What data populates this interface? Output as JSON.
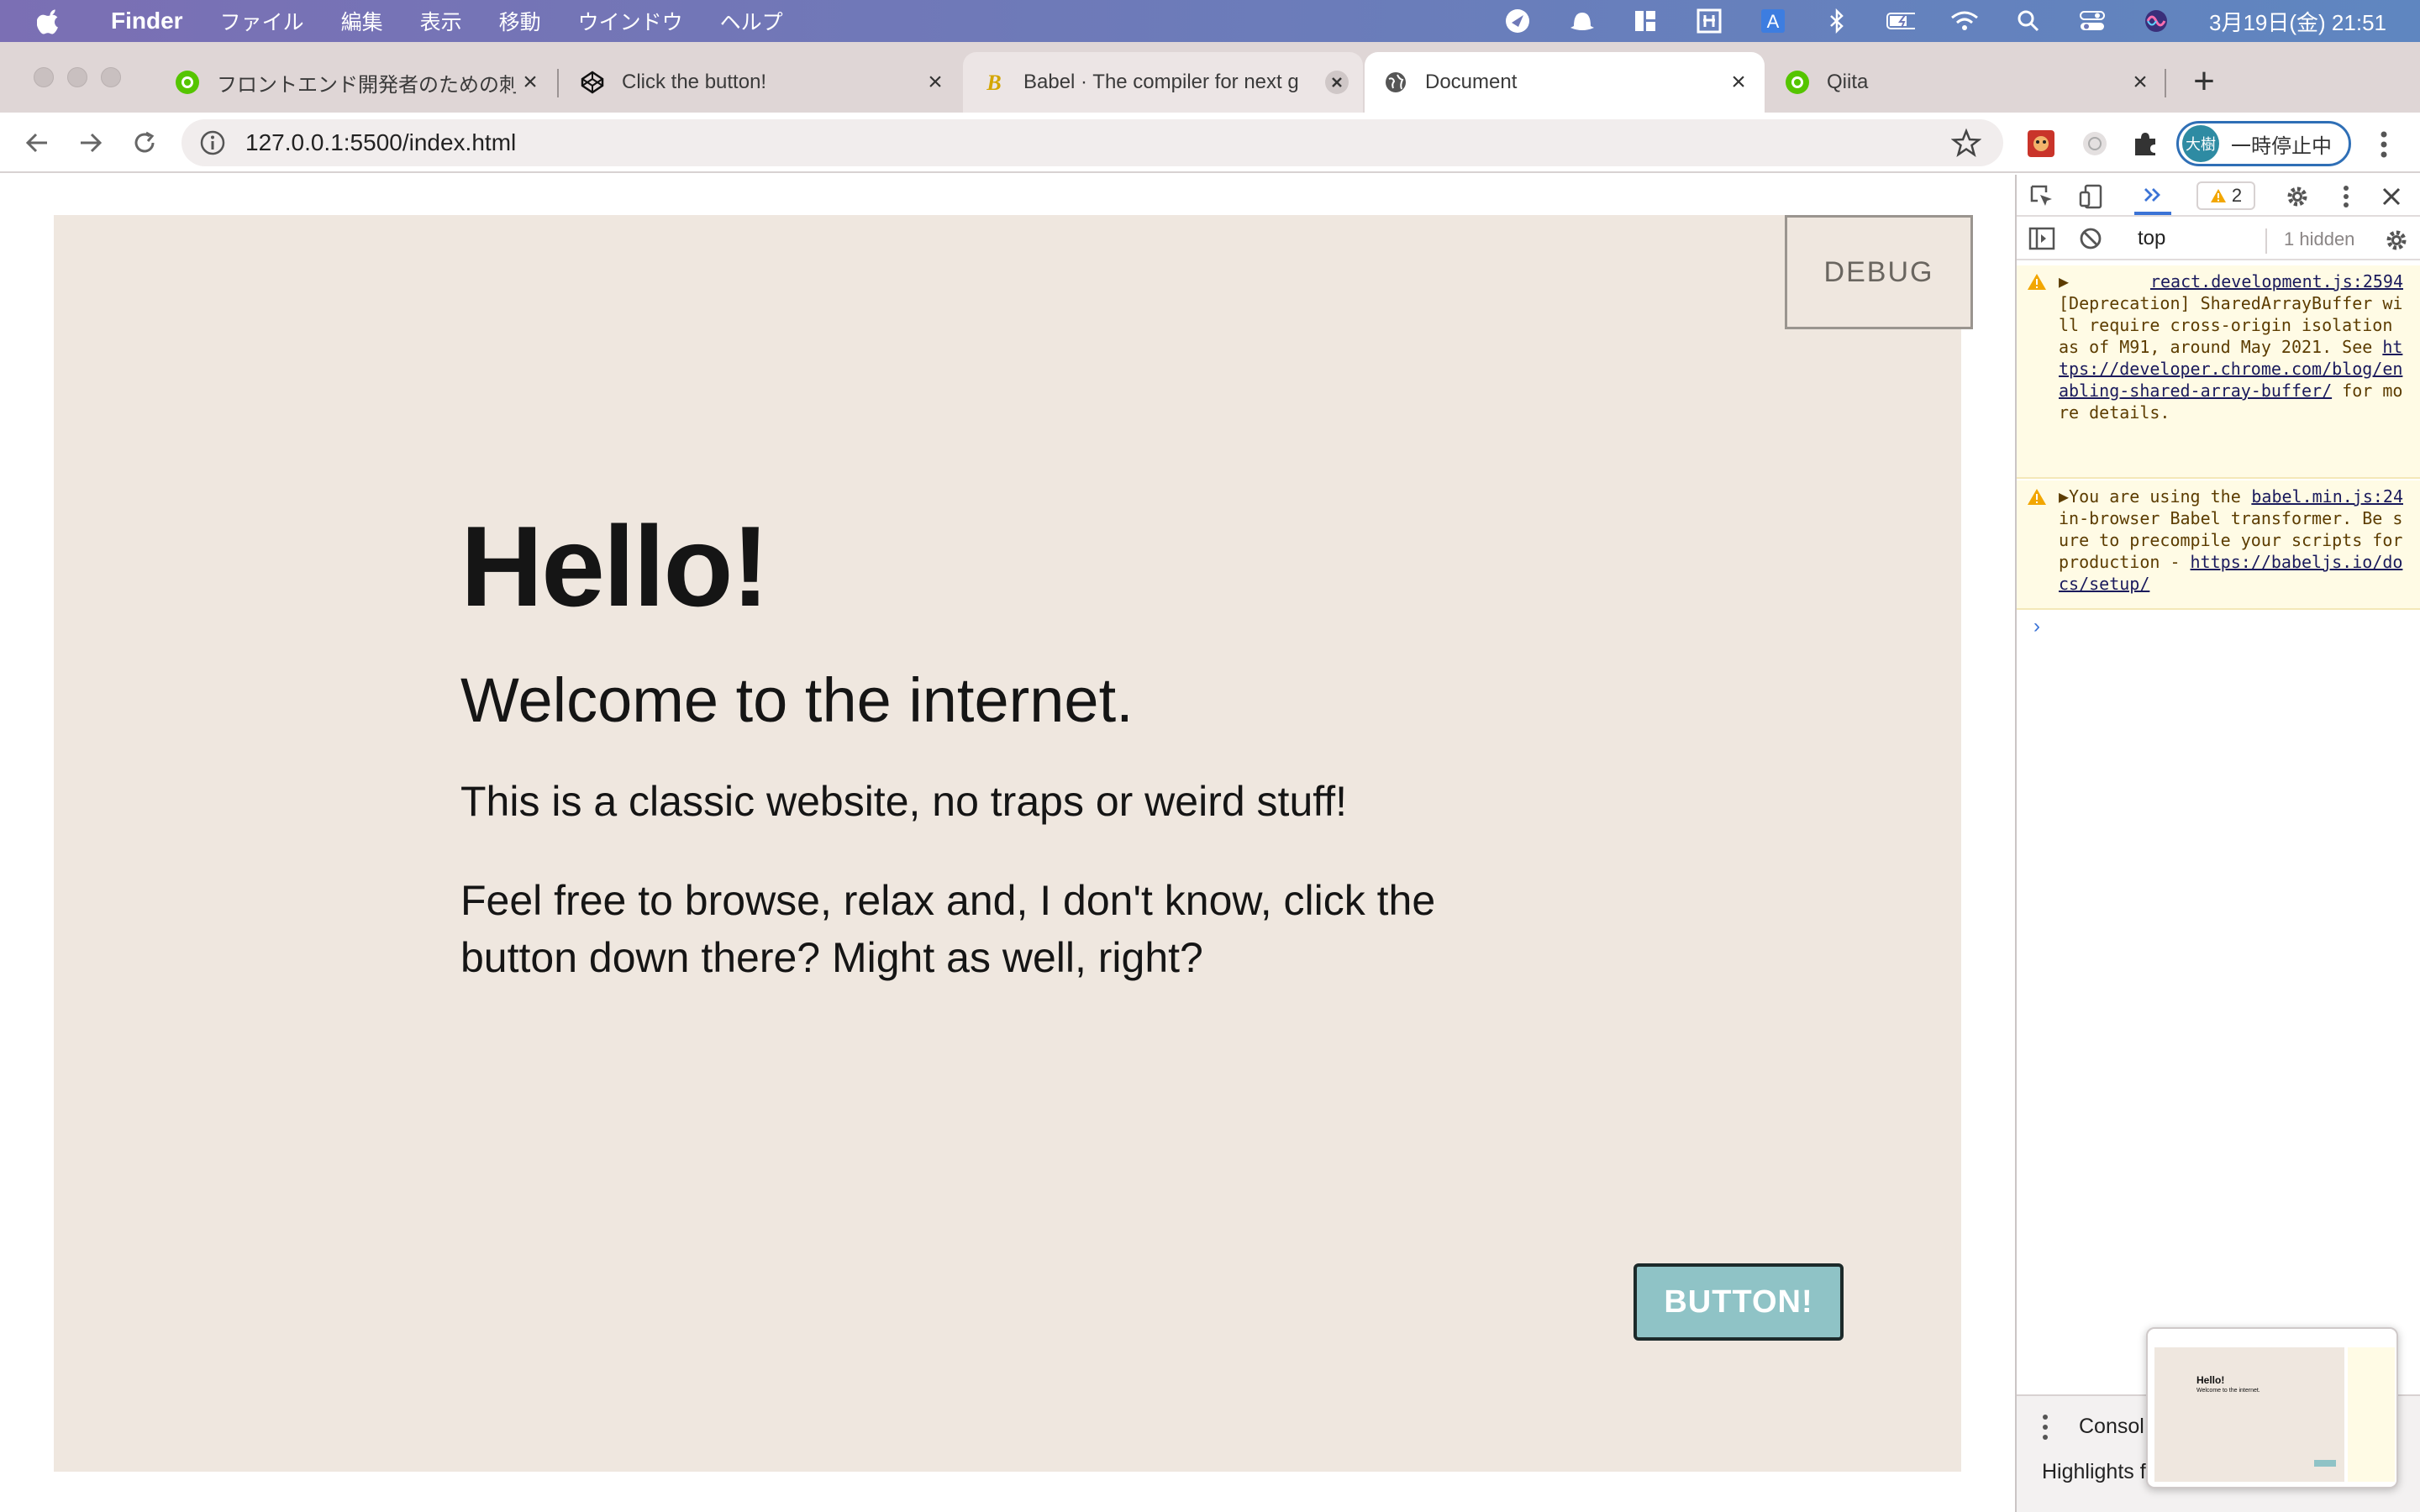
{
  "menubar": {
    "app": "Finder",
    "items": [
      "ファイル",
      "編集",
      "表示",
      "移動",
      "ウインドウ",
      "ヘルプ"
    ],
    "clock": "3月19日(金)  21:51"
  },
  "tabs": [
    {
      "label": "フロントエンド開発者のための刺激",
      "icon": "qiita-icon"
    },
    {
      "label": "Click the button!",
      "icon": "codepen-icon"
    },
    {
      "label": "Babel · The compiler for next g",
      "icon": "babel-icon"
    },
    {
      "label": "Document",
      "icon": "globe-icon"
    },
    {
      "label": "Qiita",
      "icon": "qiita-icon"
    }
  ],
  "toolbar": {
    "url": "127.0.0.1:5500/index.html",
    "profile_avatar": "大樹",
    "profile_status": "一時停止中"
  },
  "page": {
    "debug_label": "DEBUG",
    "heading": "Hello!",
    "subheading": "Welcome to the internet.",
    "paragraph1": "This is a classic website, no traps or weird stuff!",
    "paragraph2": "Feel free to browse, relax and, I don't know, click the button down there? Might as well, right?",
    "button_label": "BUTTON!",
    "background_color": "#efe7df",
    "button_color": "#8fc3c6"
  },
  "devtools": {
    "warning_count": "2",
    "context": "top",
    "hidden_label": "1 hidden",
    "messages": [
      {
        "source": "react.development.js:2594",
        "text": "[Deprecation] SharedArrayBuffer will require cross-origin isolation as of M91, around May 2021. See ",
        "link": "https://developer.chrome.com/blog/enabling-shared-array-buffer/",
        "suffix": " for more details."
      },
      {
        "source": "babel.min.js:24",
        "text": "You are using the in-browser Babel transformer. Be sure to precompile your scripts for production - ",
        "link": "https://babeljs.io/docs/setup/",
        "suffix": ""
      }
    ],
    "drawer_tab": "Consol",
    "drawer_text": "Highlights f"
  },
  "thumbnail": {
    "title": "Hello!",
    "subtitle": "Welcome to the internet."
  }
}
